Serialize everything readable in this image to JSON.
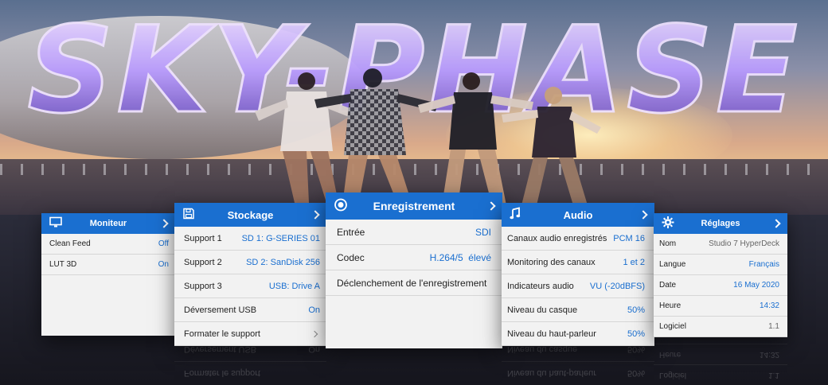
{
  "banner": {
    "logo_text": "SKY-PHASE"
  },
  "panels": {
    "monitor": {
      "title": "Moniteur",
      "icon": "monitor-icon",
      "rows": [
        {
          "label": "Clean Feed",
          "value": "Off"
        },
        {
          "label": "LUT 3D",
          "value": "On"
        }
      ]
    },
    "storage": {
      "title": "Stockage",
      "icon": "floppy-disk-icon",
      "rows": [
        {
          "label": "Support 1",
          "value": "SD 1: G-SERIES 01"
        },
        {
          "label": "Support 2",
          "value": "SD 2: SanDisk 256"
        },
        {
          "label": "Support 3",
          "value": "USB: Drive A"
        },
        {
          "label": "Déversement USB",
          "value": "On"
        },
        {
          "label": "Formater le support",
          "value": ""
        }
      ]
    },
    "recording": {
      "title": "Enregistrement",
      "icon": "record-icon",
      "rows": [
        {
          "label": "Entrée",
          "value": "SDI"
        },
        {
          "label": "Codec",
          "value": "H.264/5  élevé"
        },
        {
          "label": "Déclenchement de l'enregistrement",
          "value": ""
        }
      ]
    },
    "audio": {
      "title": "Audio",
      "icon": "music-note-icon",
      "rows": [
        {
          "label": "Canaux audio enregistrés",
          "value": "PCM 16"
        },
        {
          "label": "Monitoring des canaux",
          "value": "1 et 2"
        },
        {
          "label": "Indicateurs audio",
          "value": "VU (-20dBFS)"
        },
        {
          "label": "Niveau du casque",
          "value": "50%"
        },
        {
          "label": "Niveau du haut-parleur",
          "value": "50%"
        }
      ]
    },
    "settings": {
      "title": "Réglages",
      "icon": "gear-icon",
      "rows": [
        {
          "label": "Nom",
          "value": "Studio 7 HyperDeck"
        },
        {
          "label": "Langue",
          "value": "Français"
        },
        {
          "label": "Date",
          "value": "16 May 2020"
        },
        {
          "label": "Heure",
          "value": "14:32"
        },
        {
          "label": "Logiciel",
          "value": "1.1"
        }
      ]
    }
  },
  "colors": {
    "accent": "#1a6fd0",
    "panel_bg": "#f2f2f2",
    "value_text": "#1a6fd0"
  }
}
